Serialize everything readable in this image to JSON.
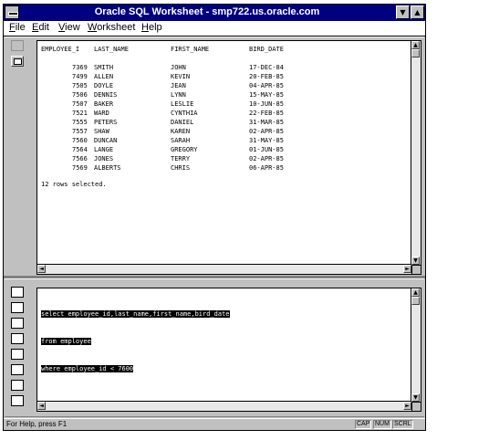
{
  "window": {
    "title": "Oracle SQL Worksheet - smp722.us.oracle.com"
  },
  "menu": [
    {
      "label": "File",
      "mnemonic": "F"
    },
    {
      "label": "Edit",
      "mnemonic": "E"
    },
    {
      "label": "View",
      "mnemonic": "V"
    },
    {
      "label": "Worksheet",
      "mnemonic": "W"
    },
    {
      "label": "Help",
      "mnemonic": "H"
    }
  ],
  "results": {
    "headers": [
      "EMPLOYEE_I",
      "LAST_NAME",
      "FIRST_NAME",
      "BIRD_DATE"
    ],
    "rows": [
      [
        "7369",
        "SMITH",
        "JOHN",
        "17-DEC-84"
      ],
      [
        "7499",
        "ALLEN",
        "KEVIN",
        "20-FEB-85"
      ],
      [
        "7505",
        "DOYLE",
        "JEAN",
        "04-APR-85"
      ],
      [
        "7506",
        "DENNIS",
        "LYNN",
        "15-MAY-85"
      ],
      [
        "7507",
        "BAKER",
        "LESLIE",
        "10-JUN-85"
      ],
      [
        "7521",
        "WARD",
        "CYNTHIA",
        "22-FEB-85"
      ],
      [
        "7555",
        "PETERS",
        "DANIEL",
        "31-MAR-85"
      ],
      [
        "7557",
        "SHAW",
        "KAREN",
        "02-APR-85"
      ],
      [
        "7560",
        "DUNCAN",
        "SARAH",
        "31-MAY-85"
      ],
      [
        "7564",
        "LANGE",
        "GREGORY",
        "01-JUN-85"
      ],
      [
        "7566",
        "JONES",
        "TERRY",
        "02-APR-85"
      ],
      [
        "7569",
        "ALBERTS",
        "CHRIS",
        "06-APR-85"
      ]
    ],
    "footer": "12 rows selected."
  },
  "editor": {
    "lines": [
      "select employee_id,last_name,first_name,bird_date",
      "from employee",
      "where employee_id < 7600"
    ]
  },
  "status": {
    "text": "For Help, press F1",
    "indicators": [
      "CAP",
      "NUM",
      "SCRL"
    ]
  },
  "icons": {
    "top_tools": [
      "erase-icon",
      "run-icon"
    ],
    "bottom_tools": [
      "clear-icon",
      "execute-icon",
      "run-script-icon",
      "spool-icon",
      "history-icon",
      "previous-command-icon",
      "next-command-icon"
    ]
  }
}
